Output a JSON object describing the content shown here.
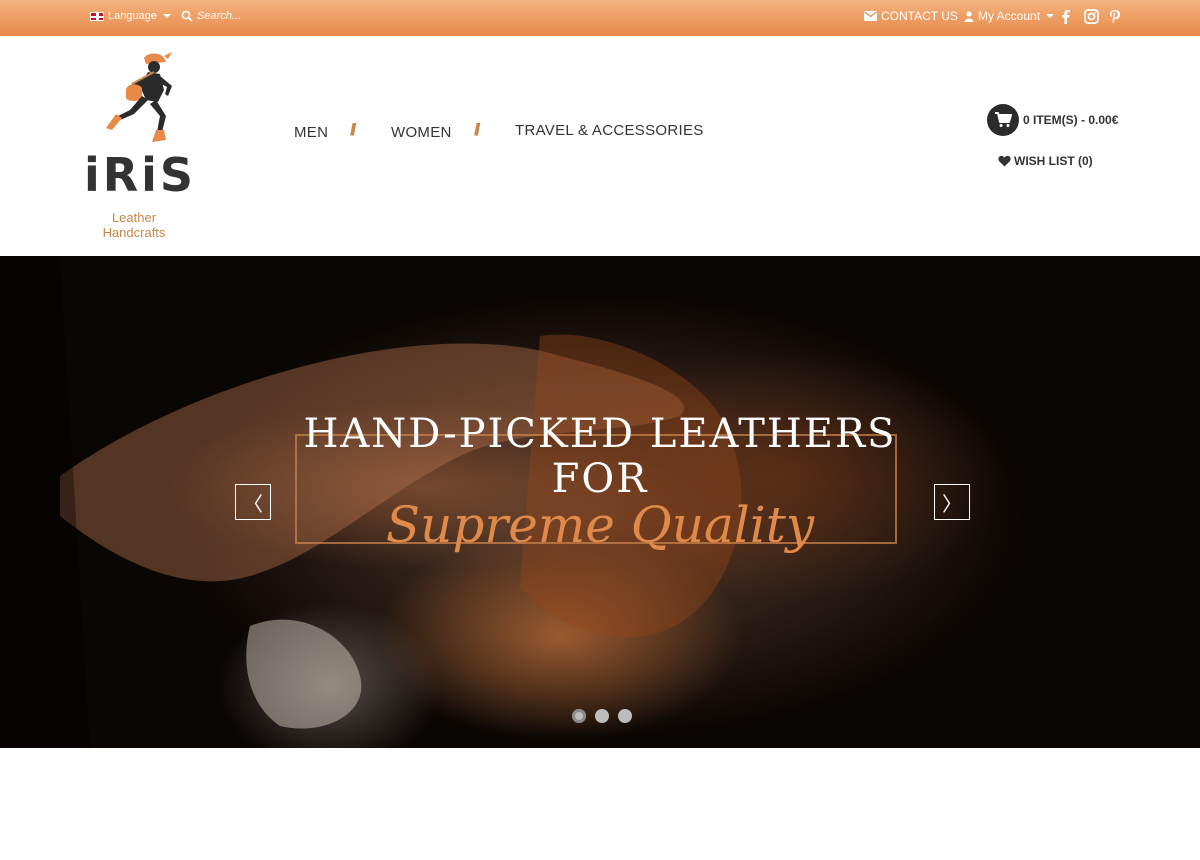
{
  "topbar": {
    "language_label": "Language",
    "search_placeholder": "Search...",
    "contact_label": "CONTACT US",
    "account_label": "My Account"
  },
  "logo": {
    "wordmark": "iRiS",
    "subtitle_line1": "Leather",
    "subtitle_line2": "Handcrafts"
  },
  "nav": {
    "items": [
      {
        "label": "MEN"
      },
      {
        "label": "WOMEN"
      },
      {
        "label": "TRAVEL & ACCESSORIES"
      }
    ],
    "separator": "//"
  },
  "cart": {
    "summary": "0 ITEM(S) - 0.00€"
  },
  "wishlist": {
    "label": "WISH LIST (0)"
  },
  "hero": {
    "line1": "HAND-PICKED LEATHERS",
    "line2": "FOR",
    "script": "Supreme Quality",
    "prev_label": "〈",
    "next_label": "〉",
    "slides_count": 3,
    "active_slide": 1
  },
  "colors": {
    "accent": "#e8894a",
    "topbar_light": "#f4b27e",
    "text_dark": "#333333"
  }
}
